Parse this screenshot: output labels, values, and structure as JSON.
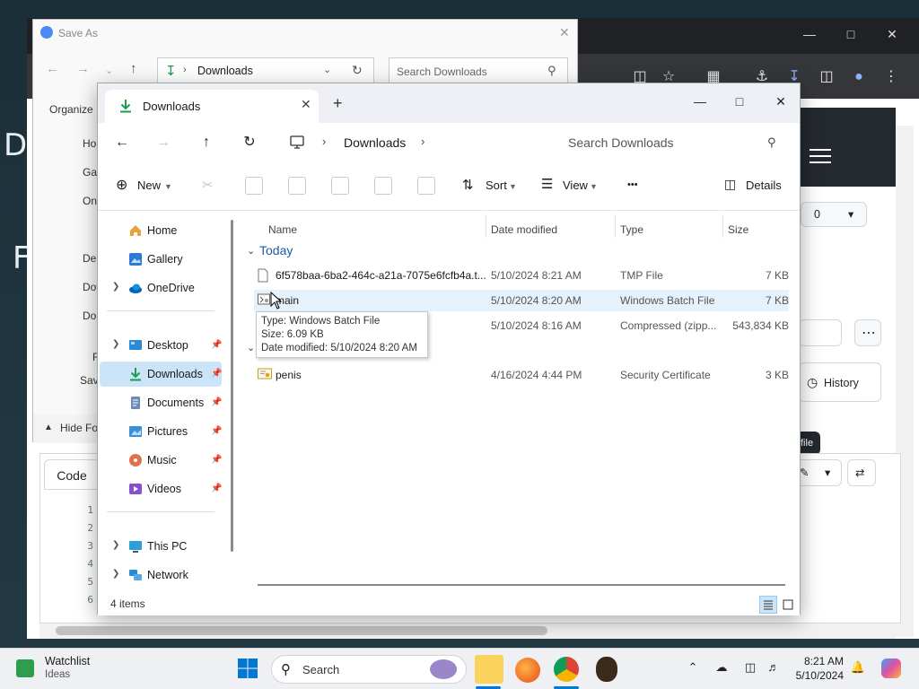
{
  "save_as": {
    "title": "Save As",
    "address_crumb": "Downloads",
    "search_placeholder": "Search Downloads",
    "organize_label": "Organize",
    "sidebar": [
      "Ho",
      "Gal",
      "On",
      "Des",
      "Dov",
      "Doc"
    ],
    "hide_folders_label": "Hide Fo",
    "save_label": "Sav",
    "filename_label": "F"
  },
  "background": {
    "code_tab_label": "Code",
    "history_label": "History",
    "counter_value": "0",
    "tooltip_fragment": "file",
    "line_numbers": [
      "1",
      "2",
      "3",
      "4",
      "5",
      "6"
    ]
  },
  "explorer": {
    "tab_title": "Downloads",
    "address": {
      "crumb": "Downloads"
    },
    "search_placeholder": "Search Downloads",
    "commands": {
      "new": "New",
      "sort": "Sort",
      "view": "View",
      "more": "•••",
      "details": "Details"
    },
    "nav": {
      "home": "Home",
      "gallery": "Gallery",
      "onedrive": "OneDrive",
      "desktop": "Desktop",
      "downloads": "Downloads",
      "documents": "Documents",
      "pictures": "Pictures",
      "music": "Music",
      "videos": "Videos",
      "this_pc": "This PC",
      "network": "Network"
    },
    "columns": {
      "name": "Name",
      "date": "Date modified",
      "type": "Type",
      "size": "Size"
    },
    "group_today": "Today",
    "files": [
      {
        "name": "6f578baa-6ba2-464c-a21a-7075e6fcfb4a.t...",
        "date": "5/10/2024 8:21 AM",
        "type": "TMP File",
        "size": "7 KB"
      },
      {
        "name": "main",
        "date": "5/10/2024 8:20 AM",
        "type": "Windows Batch File",
        "size": "7 KB"
      },
      {
        "name": "",
        "date": "5/10/2024 8:16 AM",
        "type": "Compressed (zipp...",
        "size": "543,834 KB"
      },
      {
        "name": "penis",
        "date": "4/16/2024 4:44 PM",
        "type": "Security Certificate",
        "size": "3 KB"
      }
    ],
    "tooltip": {
      "type": "Type: Windows Batch File",
      "size": "Size: 6.09 KB",
      "date": "Date modified: 5/10/2024 8:20 AM"
    },
    "status_items": "4 items"
  },
  "taskbar": {
    "widget_title": "Watchlist",
    "widget_subtitle": "Ideas",
    "search_label": "Search",
    "time": "8:21 AM",
    "date": "5/10/2024"
  },
  "colors": {
    "accent": "#0067c0",
    "download_green": "#1b9c4f",
    "selection": "#cce4f7"
  }
}
